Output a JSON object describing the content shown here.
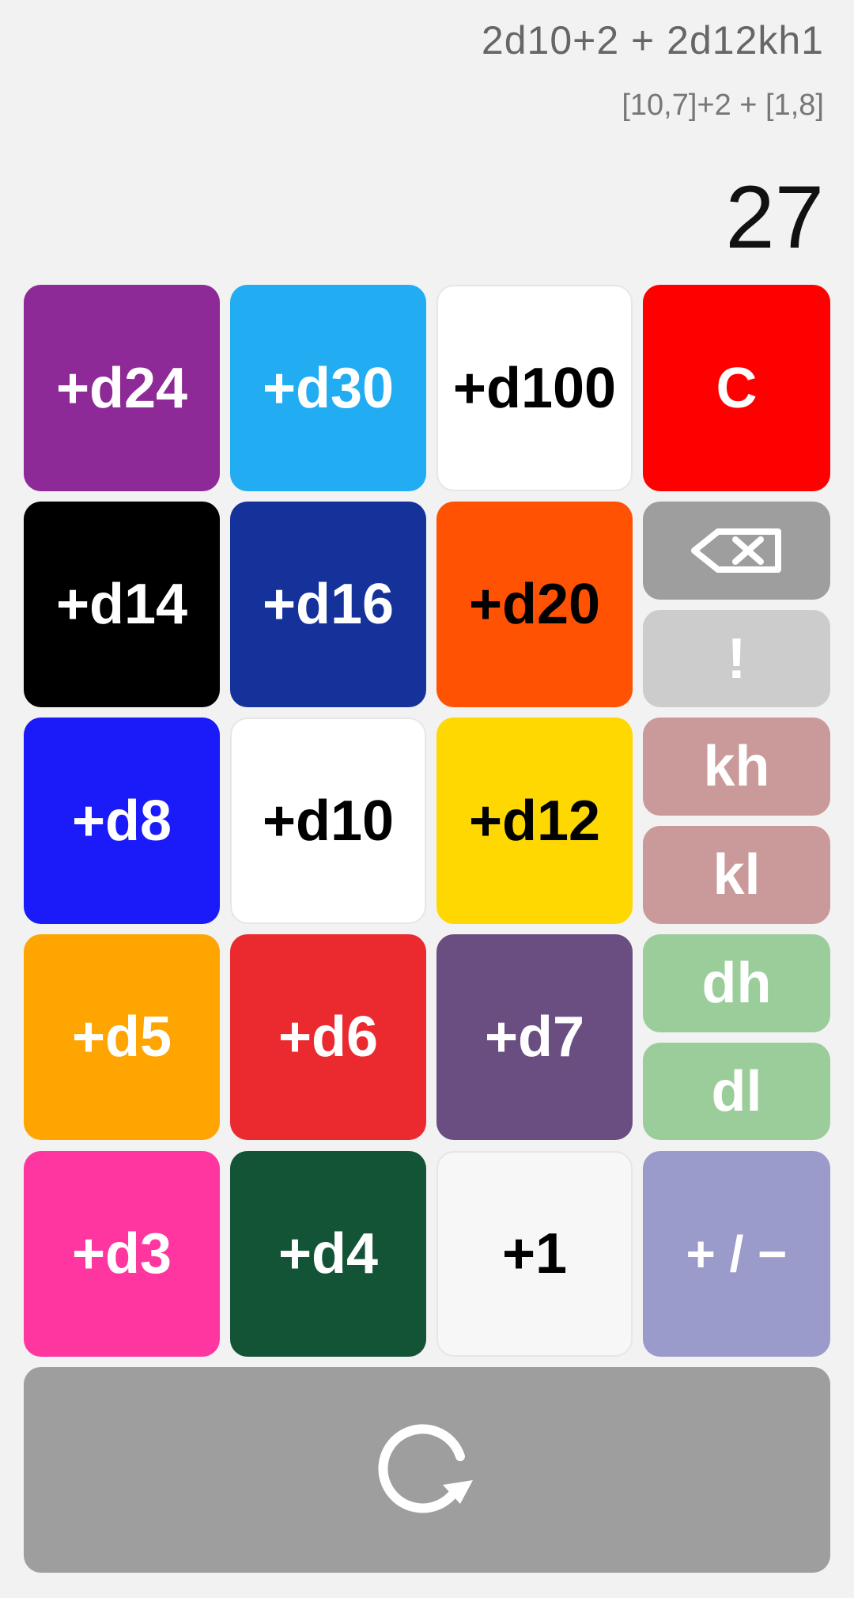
{
  "display": {
    "expression": "2d10+2 + 2d12kh1",
    "rolls": "[10,7]+2 + [1,8]",
    "total": "27"
  },
  "buttons": {
    "d24": "+d24",
    "d30": "+d30",
    "d100": "+d100",
    "clear": "C",
    "d14": "+d14",
    "d16": "+d16",
    "d20": "+d20",
    "explode": "!",
    "d8": "+d8",
    "d10": "+d10",
    "d12": "+d12",
    "keep_high": "kh",
    "keep_low": "kl",
    "d5": "+d5",
    "d6": "+d6",
    "d7": "+d7",
    "drop_high": "dh",
    "drop_low": "dl",
    "d3": "+d3",
    "d4": "+d4",
    "plus_one": "+1",
    "sign_toggle": "+ / −"
  },
  "icons": {
    "backspace": "backspace-icon",
    "reroll": "reroll-icon"
  },
  "colors": {
    "background": "#f2f2f2",
    "d24": "#8e2a97",
    "d30": "#22adf3",
    "d100": "#ffffff",
    "clear": "#ff0000",
    "d14": "#000000",
    "d16": "#15329b",
    "d20": "#ff5203",
    "backspace": "#9e9e9e",
    "explode": "#cccccc",
    "d8": "#1b1af9",
    "d10": "#ffffff",
    "d12": "#ffd801",
    "keep": "#c99a99",
    "d5": "#ffa502",
    "d6": "#ea2a2f",
    "d7": "#6a4e82",
    "drop": "#9bcd9b",
    "d3": "#ff369f",
    "d4": "#135437",
    "plus_one": "#f7f7f7",
    "sign_toggle": "#9b9bcb",
    "reroll": "#9e9e9e"
  }
}
